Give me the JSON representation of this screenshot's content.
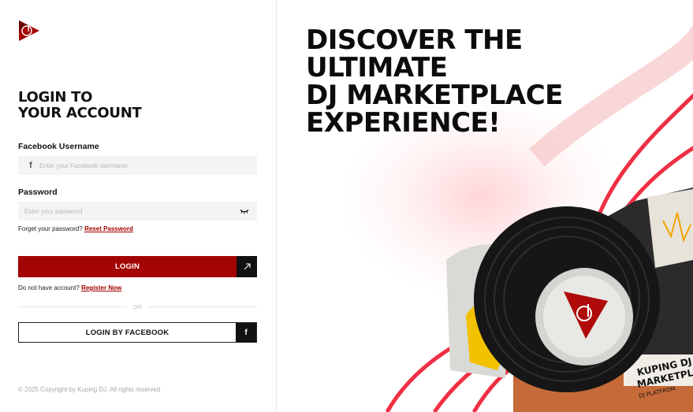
{
  "brand": {
    "logo_icon": "kuping-dj-logo-icon",
    "accent": "#a30404"
  },
  "login": {
    "heading_line1": "LOGIN TO",
    "heading_line2": "YOUR ACCOUNT",
    "username_label": "Facebook Username",
    "username_placeholder": "Enter your Facebook username",
    "password_label": "Password",
    "password_placeholder": "Enter your password",
    "forgot_text": "Forget your password?",
    "reset_link": "Reset Password",
    "login_button": "LOGIN",
    "no_account_text": "Do not have account?",
    "register_link": "Register Now",
    "or_text": "OR",
    "facebook_button": "LOGIN BY FACEBOOK",
    "copyright": "© 2025 Copyright by Kuping DJ. All rights reserved"
  },
  "hero": {
    "line1": "DISCOVER THE",
    "line2": "ULTIMATE",
    "line3": "DJ MARKETPLACE",
    "line4": "EXPERIENCE!"
  },
  "artwork": {
    "poster_text_1": "KUPING DJ",
    "poster_text_2": "MARKETPLA",
    "poster_text_3": "DJ PLATFROM."
  }
}
